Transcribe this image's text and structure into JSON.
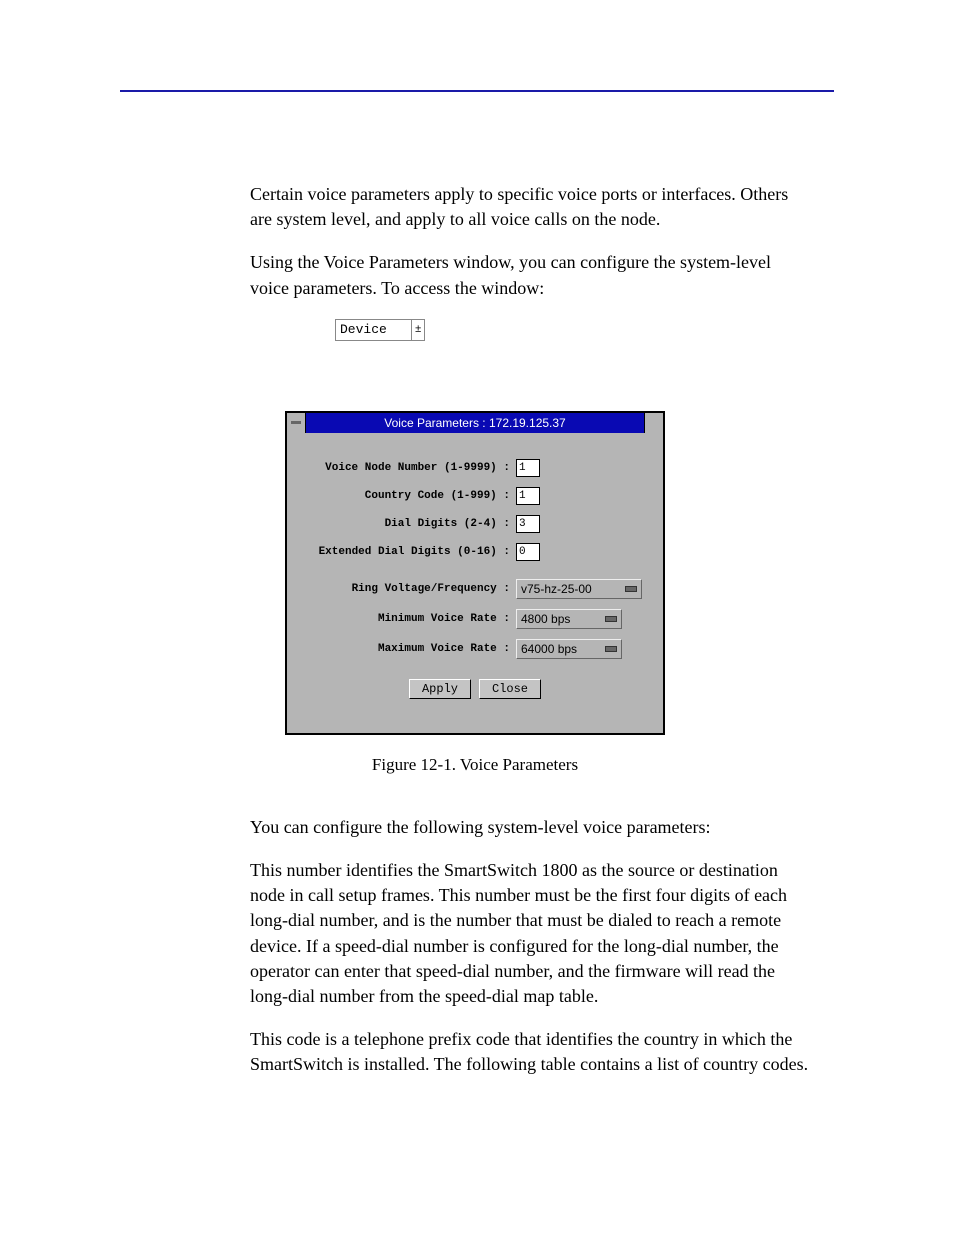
{
  "paragraphs": {
    "p1": "Certain voice parameters apply to specific voice ports or interfaces. Others are system level, and apply to all voice calls on the node.",
    "p2": "Using the Voice Parameters window, you can configure the system-level voice parameters. To access the window:",
    "p3": "You can configure the following system-level voice parameters:",
    "p4": "This number identifies the SmartSwitch 1800 as the source or destination node in call setup frames. This number must be the first four digits of each long-dial number, and is the number that must be dialed to reach a remote device. If a speed-dial number is configured for the long-dial number, the operator can enter that speed-dial number, and the firmware will read the long-dial number from the speed-dial map table.",
    "p5": "This code is a telephone prefix code that identifies the country in which the SmartSwitch is installed. The following table contains a list of country codes."
  },
  "device_dropdown": {
    "label": "Device",
    "glyph": "±"
  },
  "dialog": {
    "title": "Voice Parameters : 172.19.125.37",
    "fields": {
      "voice_node_number": {
        "label": "Voice Node Number (1-9999) :",
        "value": "1"
      },
      "country_code": {
        "label": "Country Code (1-999) :",
        "value": "1"
      },
      "dial_digits": {
        "label": "Dial Digits (2-4) :",
        "value": "3"
      },
      "ext_dial_digits": {
        "label": "Extended Dial Digits (0-16) :",
        "value": "0"
      },
      "ring_voltage": {
        "label": "Ring Voltage/Frequency :",
        "value": "v75-hz-25-00"
      },
      "min_voice_rate": {
        "label": "Minimum Voice Rate :",
        "value": "4800 bps"
      },
      "max_voice_rate": {
        "label": "Maximum Voice Rate :",
        "value": "64000 bps"
      }
    },
    "buttons": {
      "apply": "Apply",
      "close": "Close"
    }
  },
  "figure_caption": "Figure 12-1.  Voice Parameters"
}
